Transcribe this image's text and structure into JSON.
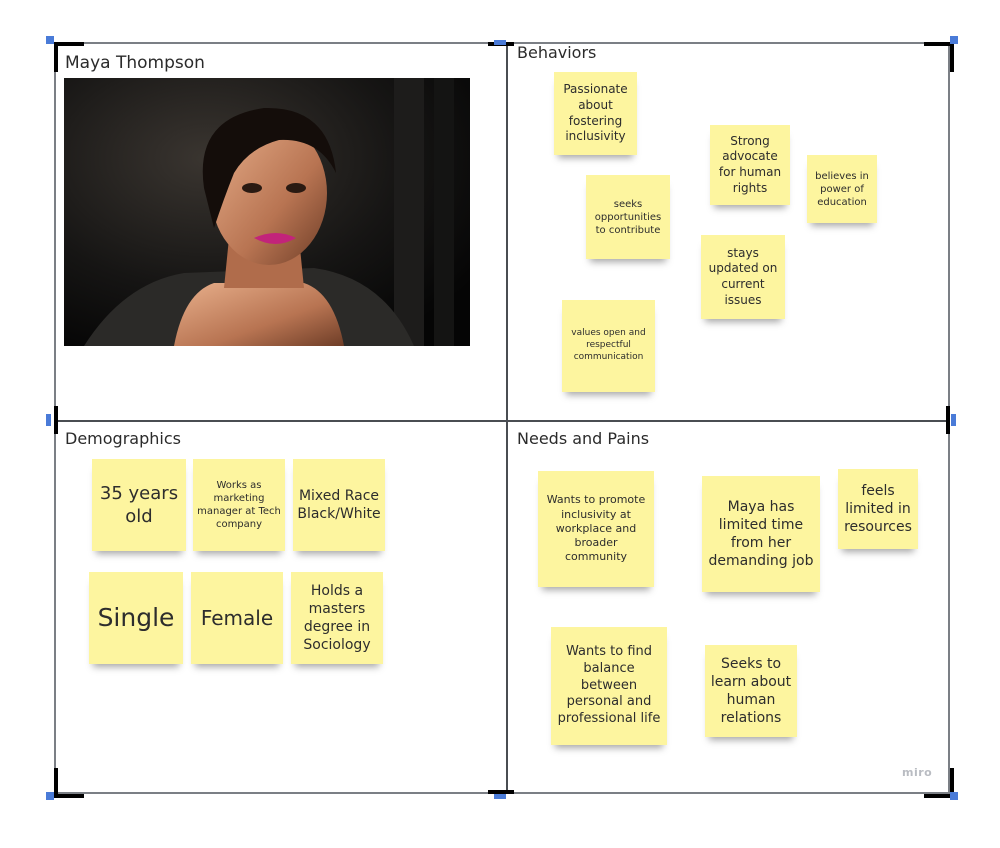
{
  "persona": {
    "name": "Maya Thompson",
    "photo_alt": "portrait photo"
  },
  "sections": {
    "behaviors": {
      "title": "Behaviors",
      "notes": [
        "Passionate about fostering inclusivity",
        "Strong advocate for human rights",
        "believes in power of education",
        "seeks opportunities to contribute",
        "stays updated on current issues",
        "values open and respectful communication"
      ]
    },
    "demographics": {
      "title": "Demographics",
      "notes": [
        "35 years old",
        "Works as marketing manager at Tech company",
        "Mixed Race Black/White",
        "Single",
        "Female",
        "Holds a masters degree in Sociology"
      ]
    },
    "needs_pains": {
      "title": "Needs and Pains",
      "notes": [
        "Wants to promote inclusivity at workplace and broader community",
        "Maya has limited time from her demanding job",
        "feels limited in resources",
        "Wants to find balance between personal and professional life",
        "Seeks to learn about human relations"
      ]
    }
  },
  "watermark": "miro",
  "colors": {
    "sticky": "#fdf59f",
    "selection_handle": "#4a7bd8",
    "frame_line": "#4a4d52"
  }
}
